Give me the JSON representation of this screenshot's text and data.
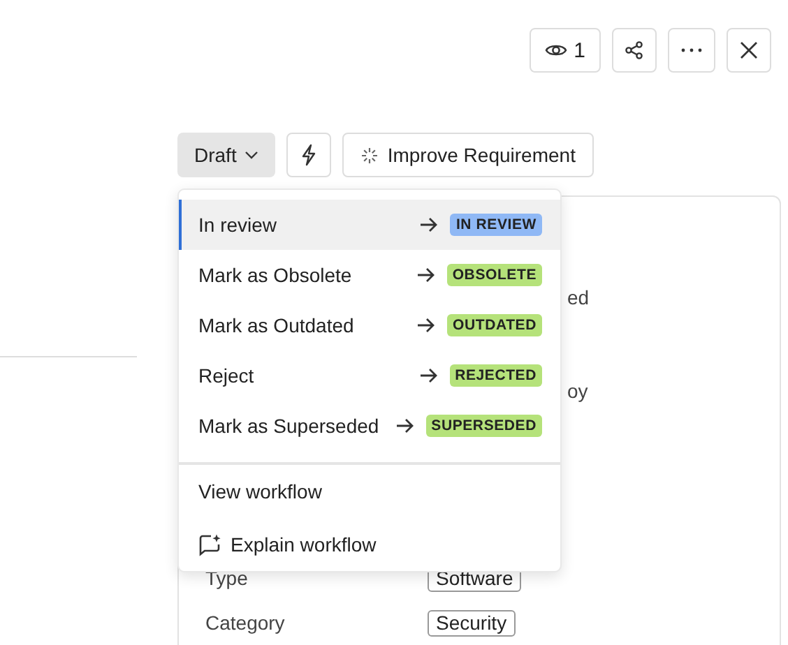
{
  "header_actions": {
    "viewers": "1"
  },
  "toolbar": {
    "status": "Draft",
    "improve_button": "Improve Requirement"
  },
  "status_menu": {
    "transitions": [
      {
        "label": "In review",
        "badge": "IN REVIEW",
        "color": "#8fb8f5",
        "selected": true
      },
      {
        "label": "Mark as Obsolete",
        "badge": "OBSOLETE",
        "color": "#b5e27a",
        "selected": false
      },
      {
        "label": "Mark as Outdated",
        "badge": "OUTDATED",
        "color": "#b5e27a",
        "selected": false
      },
      {
        "label": "Reject",
        "badge": "REJECTED",
        "color": "#b5e27a",
        "selected": false
      },
      {
        "label": "Mark as Superseded",
        "badge": "SUPERSEDED",
        "color": "#b5e27a",
        "selected": false
      }
    ],
    "view_workflow": "View workflow",
    "explain_workflow": "Explain workflow"
  },
  "details": [
    {
      "kind": "fragment",
      "value": "ed"
    },
    {
      "kind": "fragment",
      "value": "oy"
    },
    {
      "kind": "field",
      "label": "Type",
      "value": "Software"
    },
    {
      "kind": "field",
      "label": "Category",
      "value": "Security"
    }
  ]
}
